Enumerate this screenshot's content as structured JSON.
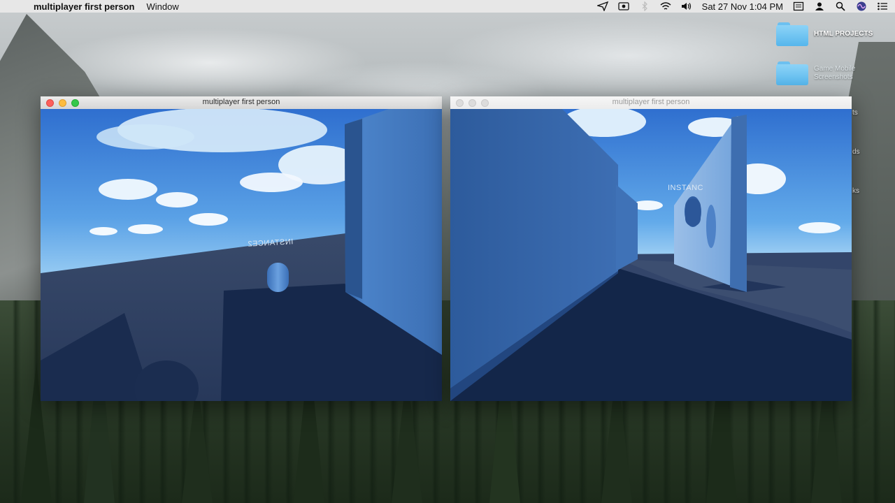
{
  "menubar": {
    "app_name": "multiplayer first person",
    "menus": [
      "Window"
    ],
    "datetime": "Sat 27 Nov  1:04 PM",
    "status_icons": [
      "location-icon",
      "screen-record-icon",
      "bluetooth-icon",
      "wifi-icon",
      "volume-icon",
      "display-icon",
      "user-icon",
      "search-icon",
      "siri-icon",
      "notification-center-icon"
    ]
  },
  "desktop": {
    "icons": [
      {
        "label": "HTML PROJECTS",
        "icon": "folder-icon"
      },
      {
        "label": "Game Mobile Screenshots",
        "icon": "folder-icon"
      }
    ],
    "peek_labels": [
      "ts",
      "ds",
      "ks"
    ]
  },
  "windows": [
    {
      "title": "multiplayer first person",
      "active": true,
      "player_tag": "INSTANCE2",
      "player_tag_mirrored": true
    },
    {
      "title": "multiplayer first person",
      "active": false,
      "player_tag": "INSTANC"
    }
  ],
  "colors": {
    "sky_top": "#3a7bd5",
    "sky_bottom": "#9fd1f5",
    "floor": "#2c3d5e",
    "wall_light": "#5c8fcf",
    "wall_dark": "#2e5a96",
    "shadow": "#13264a",
    "player": "#4a83c9"
  }
}
